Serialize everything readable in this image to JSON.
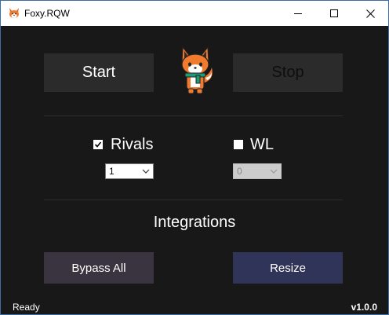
{
  "window": {
    "title": "Foxy.RQW",
    "app_icon": "fox-icon",
    "controls": {
      "minimize": "minimize-icon",
      "maximize": "maximize-icon",
      "close": "close-icon"
    }
  },
  "actions": {
    "start_label": "Start",
    "stop_label": "Stop"
  },
  "mascot": "fox-mascot",
  "options": {
    "rivals": {
      "label": "Rivals",
      "checked": true,
      "select_value": "1"
    },
    "wl": {
      "label": "WL",
      "checked": false,
      "select_value": "0"
    }
  },
  "integrations": {
    "heading": "Integrations",
    "bypass_label": "Bypass All",
    "resize_label": "Resize"
  },
  "footer": {
    "status": "Ready",
    "version": "v1.0.0"
  },
  "colors": {
    "background": "#181818",
    "button": "#2b2b2b",
    "bypass_button": "#3a3340",
    "resize_button": "#313459",
    "accent_orange": "#f07b2f"
  }
}
